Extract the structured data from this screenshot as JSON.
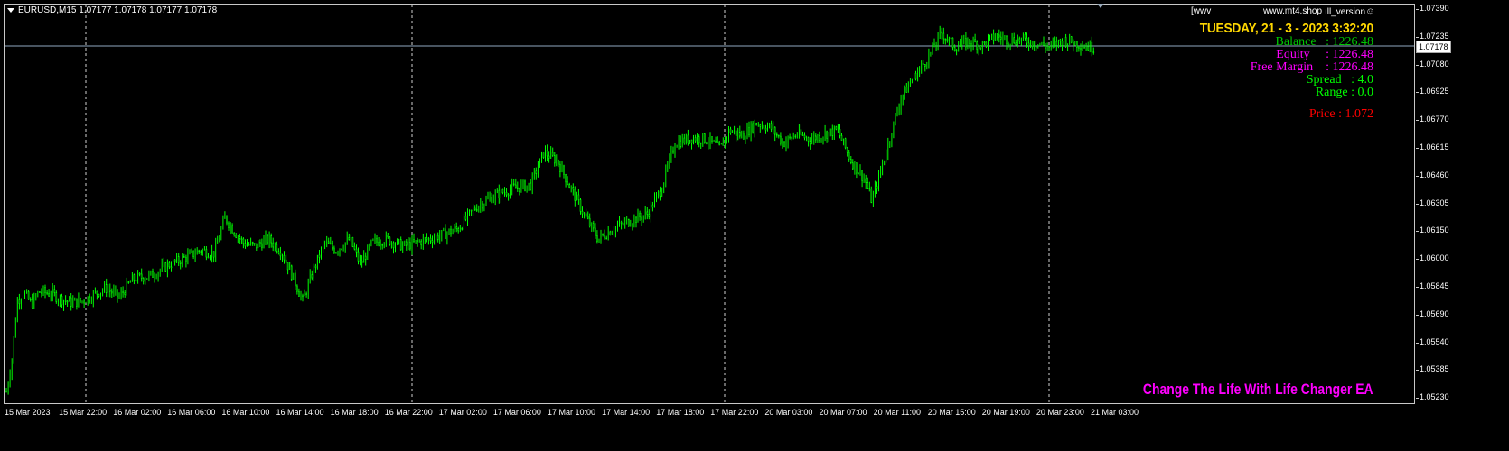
{
  "header": {
    "symbol_info": "EURUSD,M15  1.07177 1.07178 1.07177 1.07178",
    "bracket_label": "[wwv",
    "site_label": "www.mt4.shop",
    "version_label": "ıll_version",
    "smiley": "☺"
  },
  "info_panel": {
    "date_time": "TUESDAY, 21 - 3 - 2023 3:32:20",
    "balance": "Balance   : 1226.48",
    "equity": "Equity     : 1226.48",
    "free_margin": "Free Margin    : 1226.48",
    "spread": "Spread   : 4.0",
    "range": "Range : 0.0",
    "price": "Price : 1.072",
    "slogan": "Change The Life With Life Changer EA",
    "colors": {
      "date": "#ffd700",
      "balance": "#00c800",
      "equity": "#ff00ff",
      "free_margin": "#ff00ff",
      "spread": "#00ff00",
      "range": "#00ff00",
      "price": "#ff0000",
      "slogan": "#ff00ff"
    }
  },
  "price_axis": {
    "ticks": [
      "1.07390",
      "1.07235",
      "1.07080",
      "1.06925",
      "1.06770",
      "1.06615",
      "1.06460",
      "1.06305",
      "1.06150",
      "1.06000",
      "1.05845",
      "1.05690",
      "1.05540",
      "1.05385",
      "1.05230"
    ],
    "current": "1.07178"
  },
  "time_axis": {
    "ticks": [
      "15 Mar 2023",
      "15 Mar 22:00",
      "16 Mar 02:00",
      "16 Mar 06:00",
      "16 Mar 10:00",
      "16 Mar 14:00",
      "16 Mar 18:00",
      "16 Mar 22:00",
      "17 Mar 02:00",
      "17 Mar 06:00",
      "17 Mar 10:00",
      "17 Mar 14:00",
      "17 Mar 18:00",
      "17 Mar 22:00",
      "20 Mar 03:00",
      "20 Mar 07:00",
      "20 Mar 11:00",
      "20 Mar 15:00",
      "20 Mar 19:00",
      "20 Mar 23:00",
      "21 Mar 03:00"
    ]
  },
  "chart_data": {
    "type": "candlestick",
    "symbol": "EURUSD",
    "timeframe": "M15",
    "ylim": [
      1.0523,
      1.0739
    ],
    "current_price": 1.07178,
    "series_color": "#00ff00",
    "path": [
      [
        0,
        1.0528
      ],
      [
        6,
        1.0545
      ],
      [
        12,
        1.0578
      ],
      [
        20,
        1.0582
      ],
      [
        28,
        1.0576
      ],
      [
        36,
        1.0583
      ],
      [
        50,
        1.0582
      ],
      [
        60,
        1.0579
      ],
      [
        72,
        1.0577
      ],
      [
        85,
        1.0578
      ],
      [
        95,
        1.0581
      ],
      [
        110,
        1.0585
      ],
      [
        125,
        1.058
      ],
      [
        140,
        1.059
      ],
      [
        160,
        1.0592
      ],
      [
        180,
        1.0598
      ],
      [
        200,
        1.0602
      ],
      [
        215,
        1.0606
      ],
      [
        230,
        1.0604
      ],
      [
        242,
        1.0624
      ],
      [
        250,
        1.0618
      ],
      [
        262,
        1.061
      ],
      [
        275,
        1.0608
      ],
      [
        290,
        1.0612
      ],
      [
        305,
        1.0605
      ],
      [
        318,
        1.059
      ],
      [
        328,
        1.0578
      ],
      [
        340,
        1.0595
      ],
      [
        352,
        1.061
      ],
      [
        365,
        1.0606
      ],
      [
        380,
        1.0612
      ],
      [
        392,
        1.0598
      ],
      [
        405,
        1.061
      ],
      [
        420,
        1.0612
      ],
      [
        440,
        1.0608
      ],
      [
        460,
        1.0611
      ],
      [
        480,
        1.0614
      ],
      [
        500,
        1.0618
      ],
      [
        520,
        1.063
      ],
      [
        540,
        1.0636
      ],
      [
        560,
        1.064
      ],
      [
        580,
        1.0642
      ],
      [
        595,
        1.066
      ],
      [
        610,
        1.0655
      ],
      [
        625,
        1.064
      ],
      [
        640,
        1.0625
      ],
      [
        655,
        1.0612
      ],
      [
        672,
        1.0618
      ],
      [
        690,
        1.0622
      ],
      [
        710,
        1.0626
      ],
      [
        725,
        1.064
      ],
      [
        740,
        1.0665
      ],
      [
        760,
        1.0668
      ],
      [
        775,
        1.0667
      ],
      [
        790,
        1.0662
      ],
      [
        800,
        1.0672
      ],
      [
        815,
        1.0669
      ],
      [
        830,
        1.0676
      ],
      [
        845,
        1.0674
      ],
      [
        860,
        1.0665
      ],
      [
        875,
        1.067
      ],
      [
        890,
        1.0667
      ],
      [
        905,
        1.067
      ],
      [
        920,
        1.0672
      ],
      [
        935,
        1.0655
      ],
      [
        950,
        1.0645
      ],
      [
        958,
        1.0633
      ],
      [
        965,
        1.0645
      ],
      [
        978,
        1.0668
      ],
      [
        990,
        1.069
      ],
      [
        1005,
        1.0702
      ],
      [
        1020,
        1.0712
      ],
      [
        1035,
        1.0726
      ],
      [
        1050,
        1.0718
      ],
      [
        1065,
        1.0721
      ],
      [
        1080,
        1.0719
      ],
      [
        1095,
        1.0724
      ],
      [
        1110,
        1.0722
      ],
      [
        1125,
        1.0722
      ],
      [
        1140,
        1.072
      ],
      [
        1155,
        1.0718
      ],
      [
        1170,
        1.0722
      ],
      [
        1185,
        1.072
      ],
      [
        1200,
        1.0718
      ],
      [
        1212,
        1.07178
      ]
    ]
  }
}
